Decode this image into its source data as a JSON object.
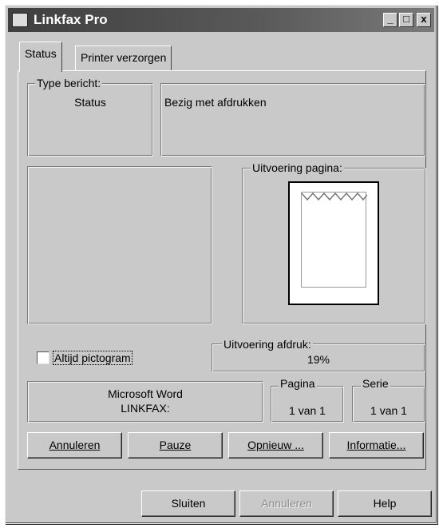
{
  "window": {
    "title": "Linkfax Pro",
    "min_symbol": "_",
    "max_symbol": "□",
    "close_symbol": "x"
  },
  "tabs": [
    {
      "label": "Status",
      "active": true
    },
    {
      "label": "Printer verzorgen",
      "active": false
    }
  ],
  "message": {
    "type_legend": "Type bericht:",
    "type_value": "Status",
    "text": "Bezig met afdrukken"
  },
  "page_progress": {
    "legend": "Uitvoering pagina:"
  },
  "options": {
    "always_icon_label": "Altijd pictogram",
    "always_icon_checked": false
  },
  "print_progress": {
    "legend": "Uitvoering afdruk:",
    "percent": "19%"
  },
  "job": {
    "application": "Microsoft Word",
    "document": "LINKFAX:",
    "page_legend": "Pagina",
    "page_value": "1 van 1",
    "series_legend": "Serie",
    "series_value": "1 van 1"
  },
  "actions": {
    "cancel": "Annuleren",
    "pause": "Pauze",
    "retry": "Opnieuw ...",
    "info": "Informatie..."
  },
  "footer": {
    "close": "Sluiten",
    "cancel": "Annuleren",
    "help": "Help"
  }
}
